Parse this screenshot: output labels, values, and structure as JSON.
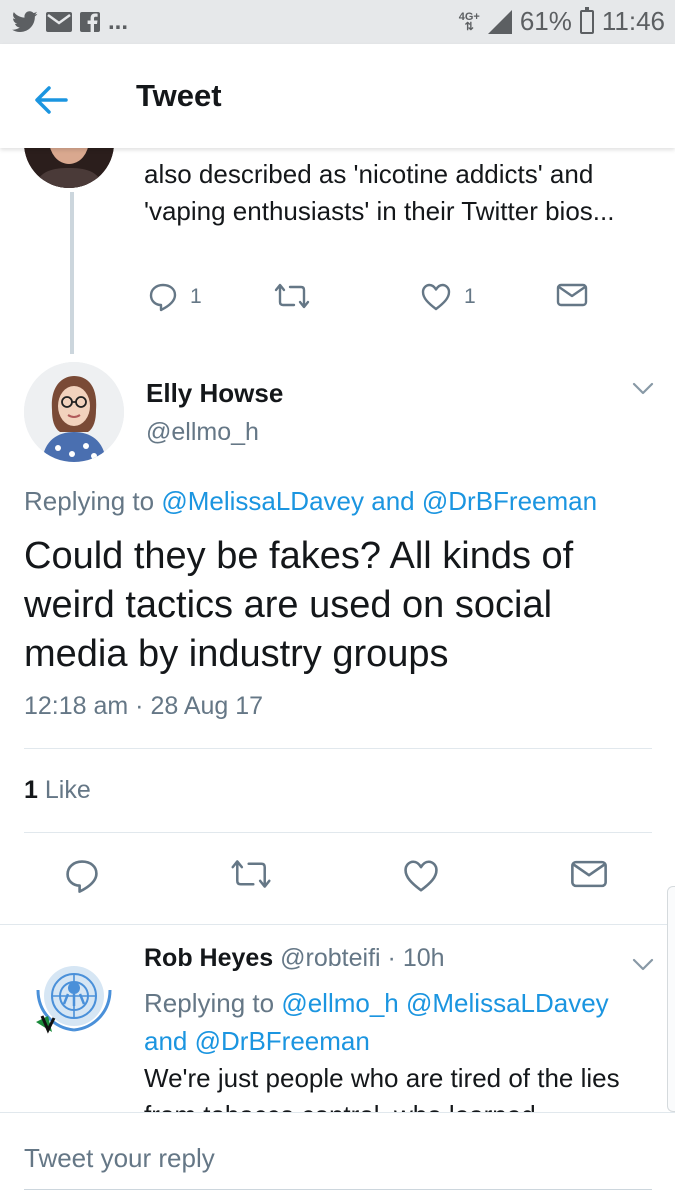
{
  "status_bar": {
    "more": "...",
    "network": "4G+",
    "battery": "61%",
    "time": "11:46"
  },
  "app_bar": {
    "title": "Tweet"
  },
  "previous_tweet": {
    "text": "also described as 'nicotine addicts' and 'vaping enthusiasts' in their Twitter bios...",
    "reply_count": "1",
    "like_count": "1"
  },
  "main_tweet": {
    "author_name": "Elly Howse",
    "author_handle": "@ellmo_h",
    "replying_prefix": "Replying to",
    "reply_to_1": "@MelissaLDavey",
    "reply_and": "and",
    "reply_to_2": "@DrBFreeman",
    "text": "Could they be fakes? All kinds of weird tactics are used on social media by industry groups",
    "timestamp": "12:18 am · 28 Aug 17",
    "likes_count": "1",
    "likes_label": "Like"
  },
  "reply_tweet": {
    "author_name": "Rob Heyes",
    "author_handle": "@robteifi",
    "time": "· 10h",
    "replying_prefix": "Replying to",
    "reply_to_1": "@ellmo_h",
    "reply_to_2": "@MelissaLDavey",
    "reply_and": "and",
    "reply_to_3": "@DrBFreeman",
    "text": "We're just people who are tired of the lies from tobacco control, who learned"
  },
  "composer": {
    "placeholder": "Tweet your reply"
  },
  "colors": {
    "accent": "#1b95e0",
    "secondary_text": "#657786",
    "divider": "#e1e8ed"
  },
  "icons": [
    "twitter-icon",
    "mail-icon",
    "facebook-icon",
    "signal-icon",
    "battery-icon",
    "back-arrow-icon",
    "reply-icon",
    "retweet-icon",
    "like-icon",
    "dm-icon",
    "chevron-down-icon"
  ]
}
